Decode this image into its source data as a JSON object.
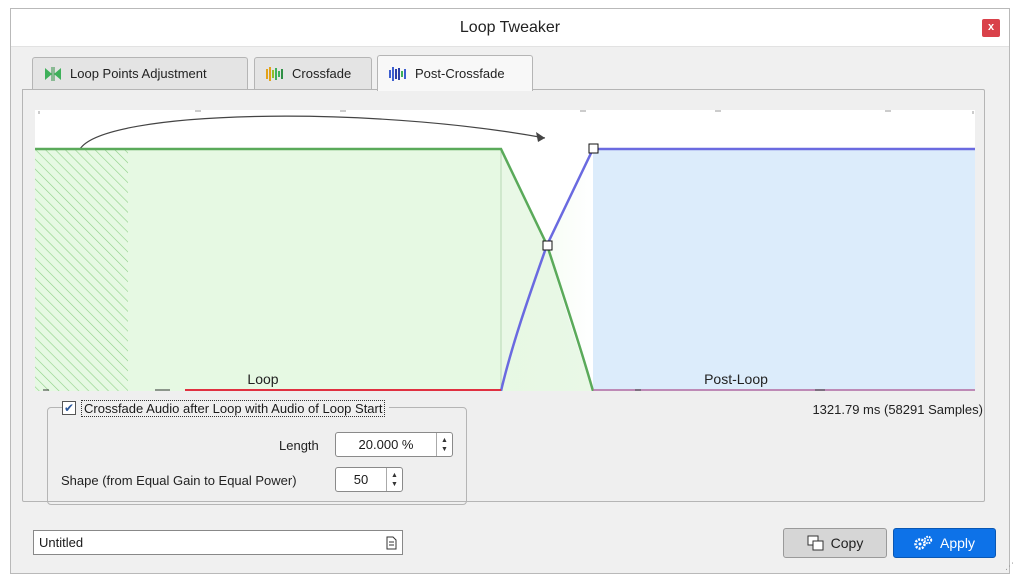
{
  "window": {
    "title": "Loop Tweaker",
    "close_label": "x"
  },
  "tabs": [
    {
      "label": "Loop Points Adjustment",
      "icon": "loop-points-icon",
      "active": false
    },
    {
      "label": "Crossfade",
      "icon": "crossfade-icon",
      "active": false
    },
    {
      "label": "Post-Crossfade",
      "icon": "post-crossfade-icon",
      "active": true
    }
  ],
  "waveform": {
    "loop_label": "Loop",
    "post_loop_label": "Post-Loop",
    "colors": {
      "loop_fill": "#e6f9e3",
      "loop_curve": "#5aaa5a",
      "post_fill": "#dcecfb",
      "post_curve": "#6a6ae0",
      "baseline": "#e03040"
    }
  },
  "crossfade": {
    "enabled": true,
    "checkbox_label": "Crossfade Audio after Loop with Audio of Loop Start",
    "length_label": "Length",
    "length_value": "20.000 %",
    "shape_label": "Shape (from Equal Gain to Equal Power)",
    "shape_value": "50"
  },
  "info": {
    "duration_text": "1321.79 ms (58291 Samples)"
  },
  "footer": {
    "preset_name": "Untitled",
    "copy_label": "Copy",
    "apply_label": "Apply"
  }
}
